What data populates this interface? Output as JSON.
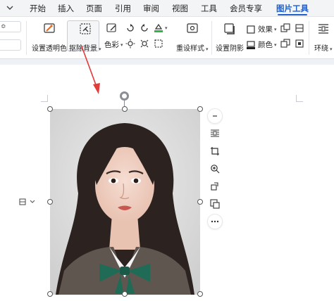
{
  "tabs": [
    {
      "label": "开始",
      "active": false
    },
    {
      "label": "插入",
      "active": false
    },
    {
      "label": "页面",
      "active": false
    },
    {
      "label": "引用",
      "active": false
    },
    {
      "label": "审阅",
      "active": false
    },
    {
      "label": "视图",
      "active": false
    },
    {
      "label": "工具",
      "active": false
    },
    {
      "label": "会员专享",
      "active": false
    },
    {
      "label": "图片工具",
      "active": true
    }
  ],
  "ribbon": {
    "left_partial": "≎",
    "set_transparent": "设置透明色",
    "remove_bg": "抠除背景",
    "color": "色彩",
    "reset_style": "重设样式",
    "set_shadow": "设置阴影",
    "effect": "效果",
    "fill_color": "颜色",
    "wrap": "环绕"
  },
  "colors": {
    "accent": "#1f5fcc",
    "arrow": "#e23b3b"
  }
}
